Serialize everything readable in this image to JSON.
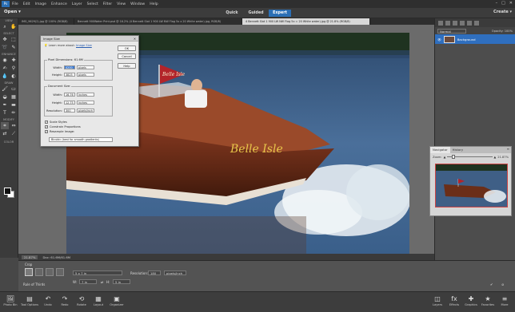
{
  "menubar": {
    "logo": "Ps",
    "items": [
      "File",
      "Edit",
      "Image",
      "Enhance",
      "Layer",
      "Select",
      "Filter",
      "View",
      "Window",
      "Help"
    ],
    "window_controls": [
      "–",
      "□",
      "✕"
    ]
  },
  "modebar": {
    "open": "Open",
    "modes": [
      "Quick",
      "Guided",
      "Expert"
    ],
    "active_mode": "Expert",
    "create": "Create"
  },
  "tabs": [
    "IMG_9629(2).jpg @ 100% (RGB/8)",
    "Bennett 900Water Print.psd @ 16.2% (4 Bennett Slot 1 900 LW NW Flag 5x x 20 White water).jpg, RGB/8)",
    "4 Bennett Slot 1 900 LW NW Flag 5x = 20 White water).jpg @ 21.8% (RGB/8)"
  ],
  "toolbox": {
    "sections": [
      "VIEW",
      "SELECT",
      "ENHANCE",
      "DRAW",
      "MODIFY",
      "COLOR"
    ]
  },
  "dialog": {
    "title": "Image Size",
    "learn_prefix": "Learn more about:",
    "learn_link": "Image Size",
    "buttons": {
      "ok": "OK",
      "cancel": "Cancel",
      "help": "Help"
    },
    "pixel_group": {
      "title": "Pixel Dimensions: 61.6M",
      "width_label": "Width:",
      "width_value": "4200",
      "width_unit": "pixels",
      "height_label": "Height:",
      "height_value": "3825",
      "height_unit": "pixels"
    },
    "doc_group": {
      "title": "Document Size:",
      "width_label": "Width:",
      "width_value": "16.76",
      "width_unit": "inches",
      "height_label": "Height:",
      "height_value": "12.75",
      "height_unit": "inches",
      "res_label": "Resolution:",
      "res_value": "300",
      "res_unit": "pixels/inch"
    },
    "checks": {
      "scale_styles": "Scale Styles",
      "constrain": "Constrain Proportions",
      "resample": "Resample Image:"
    },
    "resample_method": "Bicubic (best for smooth gradients)"
  },
  "status": {
    "zoom": "21.87%",
    "doc": "Doc: 61.6M/61.6M"
  },
  "layers_panel": {
    "mode": "Normal",
    "opacity_label": "Opacity:",
    "opacity": "100%",
    "layer_name": "Background"
  },
  "navigator": {
    "tabs": [
      "Navigator",
      "History"
    ],
    "zoom_label": "Zoom:",
    "zoom_value": "21.87%",
    "zoom_fraction": 0.1
  },
  "optbar": {
    "crop_label": "Crop",
    "rule_label": "Rule of Thirds",
    "preset": "5 x 7 in",
    "w_label": "W:",
    "w_value": "7 in",
    "h_label": "H:",
    "h_value": "5 in",
    "res_label": "Resolution:",
    "res_value": "180",
    "res_unit": "pixels/inch"
  },
  "taskbar": {
    "left": [
      "Photo Bin",
      "Tool Options",
      "Undo",
      "Redo",
      "Rotate",
      "Layout",
      "Organizer"
    ],
    "right": [
      "Layers",
      "Effects",
      "Graphics",
      "Favorites",
      "More"
    ]
  },
  "photo": {
    "boat_name": "Belle Isle",
    "flag_text": "Belle Isle"
  }
}
